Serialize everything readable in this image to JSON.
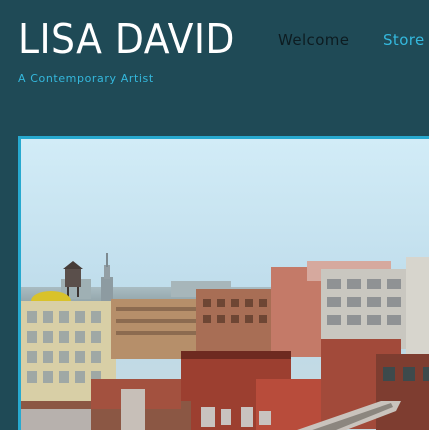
{
  "header": {
    "site_title": "LISA DAVID",
    "tagline": "A Contemporary Artist"
  },
  "nav": {
    "items": [
      {
        "label": "Welcome"
      },
      {
        "label": "Store"
      }
    ]
  },
  "colors": {
    "background": "#1f4a56",
    "accent": "#34b8dd",
    "frame_border": "#27a9cf",
    "title": "#ffffff"
  },
  "artwork": {
    "subject": "city skyline rooftop painting"
  }
}
